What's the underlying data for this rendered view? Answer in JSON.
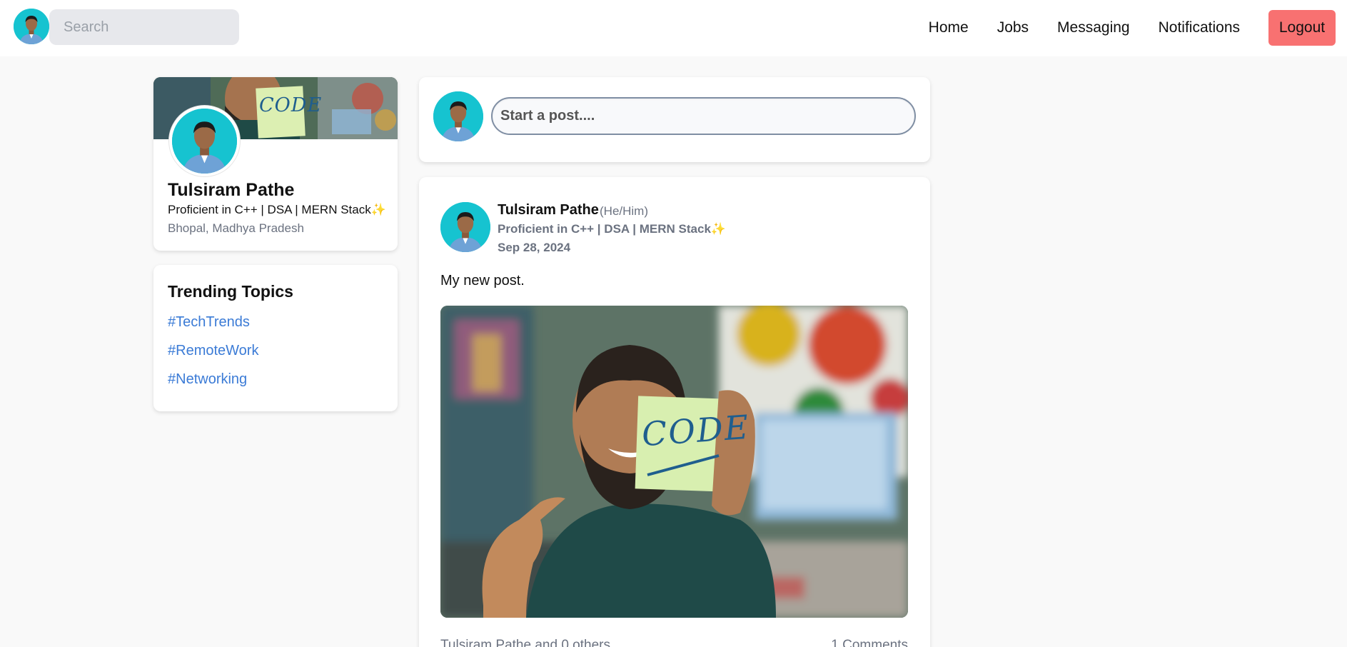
{
  "header": {
    "search_placeholder": "Search",
    "nav": [
      "Home",
      "Jobs",
      "Messaging",
      "Notifications"
    ],
    "logout_label": "Logout"
  },
  "profile": {
    "name": "Tulsiram Pathe",
    "headline": "Proficient in C++ | DSA | MERN Stack✨",
    "location": "Bhopal, Madhya Pradesh",
    "banner_note": "CODE"
  },
  "trending": {
    "title": "Trending Topics",
    "topics": [
      "#TechTrends",
      "#RemoteWork",
      "#Networking"
    ]
  },
  "composer": {
    "placeholder": "Start a post...."
  },
  "post": {
    "author": "Tulsiram Pathe",
    "pronouns": "(He/Him)",
    "headline": "Proficient in C++ | DSA | MERN Stack✨",
    "date": "Sep 28, 2024",
    "text": "My new post.",
    "image_note": "CODE",
    "likes_text": "Tulsiram Pathe and 0 others",
    "comments_text": "1 Comments"
  },
  "colors": {
    "accent_link": "#3b7bd6",
    "logout_bg": "#f87171",
    "avatar_bg": "#16c3d0",
    "page_bg": "#f9f9f9"
  }
}
